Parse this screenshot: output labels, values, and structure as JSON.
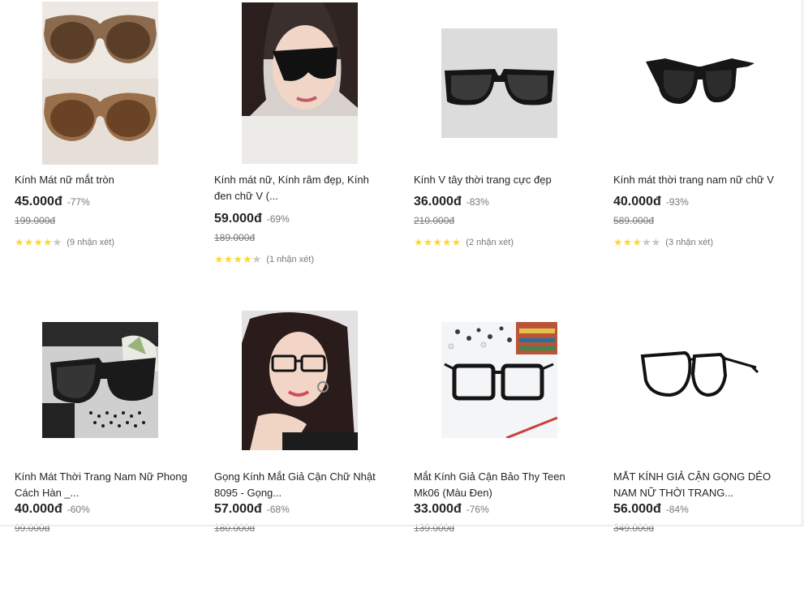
{
  "products": [
    {
      "name": "Kính Mát nữ mắt tròn",
      "price": "45.000đ",
      "discount": "-77%",
      "old_price": "199.000đ",
      "stars": 4,
      "reviews": "(9 nhận xét)",
      "image": "two-brown-round-sunglasses"
    },
    {
      "name": "Kính mát nữ, Kính râm đẹp, Kính đen chữ V (...",
      "price": "59.000đ",
      "discount": "-69%",
      "old_price": "189.000đ",
      "stars": 4,
      "reviews": "(1 nhận xét)",
      "image": "woman-wearing-sunglasses"
    },
    {
      "name": "Kính V tây thời trang cực đẹp",
      "price": "36.000đ",
      "discount": "-83%",
      "old_price": "210.000đ",
      "stars": 5,
      "reviews": "(2 nhận xét)",
      "image": "black-square-sunglasses"
    },
    {
      "name": "Kính mát thời trang nam nữ chữ V",
      "price": "40.000đ",
      "discount": "-93%",
      "old_price": "589.000đ",
      "stars": 3,
      "reviews": "(3 nhận xét)",
      "image": "black-wayfarer-sunglasses"
    },
    {
      "name": "Kính Mát Thời Trang Nam Nữ Phong Cách Hàn _...",
      "price": "40.000đ",
      "discount": "-60%",
      "old_price": "99.000đ",
      "stars": 0,
      "reviews": "",
      "image": "sunglasses-with-case"
    },
    {
      "name": "Gọng Kính Mắt Giả Cận Chữ Nhật 8095 - Gọng...",
      "price": "57.000đ",
      "discount": "-68%",
      "old_price": "180.000đ",
      "stars": 0,
      "reviews": "",
      "image": "woman-wearing-glasses"
    },
    {
      "name": "Mắt Kính Giả Cận Bảo Thy Teen Mk06 (Màu Đen)",
      "price": "33.000đ",
      "discount": "-76%",
      "old_price": "139.000đ",
      "stars": 0,
      "reviews": "",
      "image": "black-frame-glasses-on-table"
    },
    {
      "name": "MẮT KÍNH GIẢ CẬN GỌNG DẺO NAM NỮ THỜI TRANG...",
      "price": "56.000đ",
      "discount": "-84%",
      "old_price": "349.000đ",
      "stars": 0,
      "reviews": "",
      "image": "black-rectangle-glasses"
    }
  ],
  "colors": {
    "star_on": "#fdd836",
    "star_off": "#c7c7c7",
    "text": "#242424",
    "muted": "#787878"
  }
}
